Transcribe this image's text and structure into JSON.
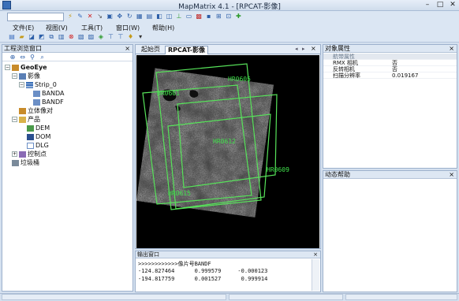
{
  "window": {
    "title": "MapMatrix 4.1 - [RPCAT-影像]",
    "minimize": "–",
    "maximize": "□",
    "close": "✕"
  },
  "menu": [
    "文件(E)",
    "视图(V)",
    "工具(T)",
    "窗口(W)",
    "帮助(H)"
  ],
  "left_panel": {
    "title": "工程浏览窗口",
    "close": "×",
    "tree": [
      {
        "label": "GeoEye",
        "bold": true
      },
      {
        "label": "影像"
      },
      {
        "label": "Strip_0"
      },
      {
        "label": "BANDA"
      },
      {
        "label": "BANDF"
      },
      {
        "label": "立体像对"
      },
      {
        "label": "产品"
      },
      {
        "label": "DEM"
      },
      {
        "label": "DOM"
      },
      {
        "label": "DLG"
      },
      {
        "label": "控制点"
      },
      {
        "label": "垃圾桶"
      }
    ]
  },
  "doc": {
    "tabs": [
      {
        "label": "起始页",
        "active": false
      },
      {
        "label": "RPCAT-影像",
        "active": true
      }
    ],
    "nav_prev": "◂",
    "nav_next": "▸",
    "close": "×",
    "image_labels": [
      "HR0601",
      "HR0605",
      "HR0612",
      "HR0609",
      "HR0615"
    ]
  },
  "output": {
    "title": "输出窗口",
    "close": "×",
    "lines": [
      ">>>>>>>>>>>>像片号BANDF",
      "-124.827464      0.999579     -0.000123",
      "-194.817759      0.001527      0.999914"
    ]
  },
  "properties": {
    "title": "对象属性",
    "close": "×",
    "group": "航带属性",
    "rows": [
      {
        "key": "RMX 相机",
        "value": "否"
      },
      {
        "key": "反转相机",
        "value": "否"
      },
      {
        "key": "扫描分辨率",
        "value": "0.019167"
      }
    ]
  },
  "help": {
    "title": "动态帮助",
    "close": "×"
  },
  "colors": {
    "overlay": "#57e35a",
    "label": "#3fe04a"
  }
}
